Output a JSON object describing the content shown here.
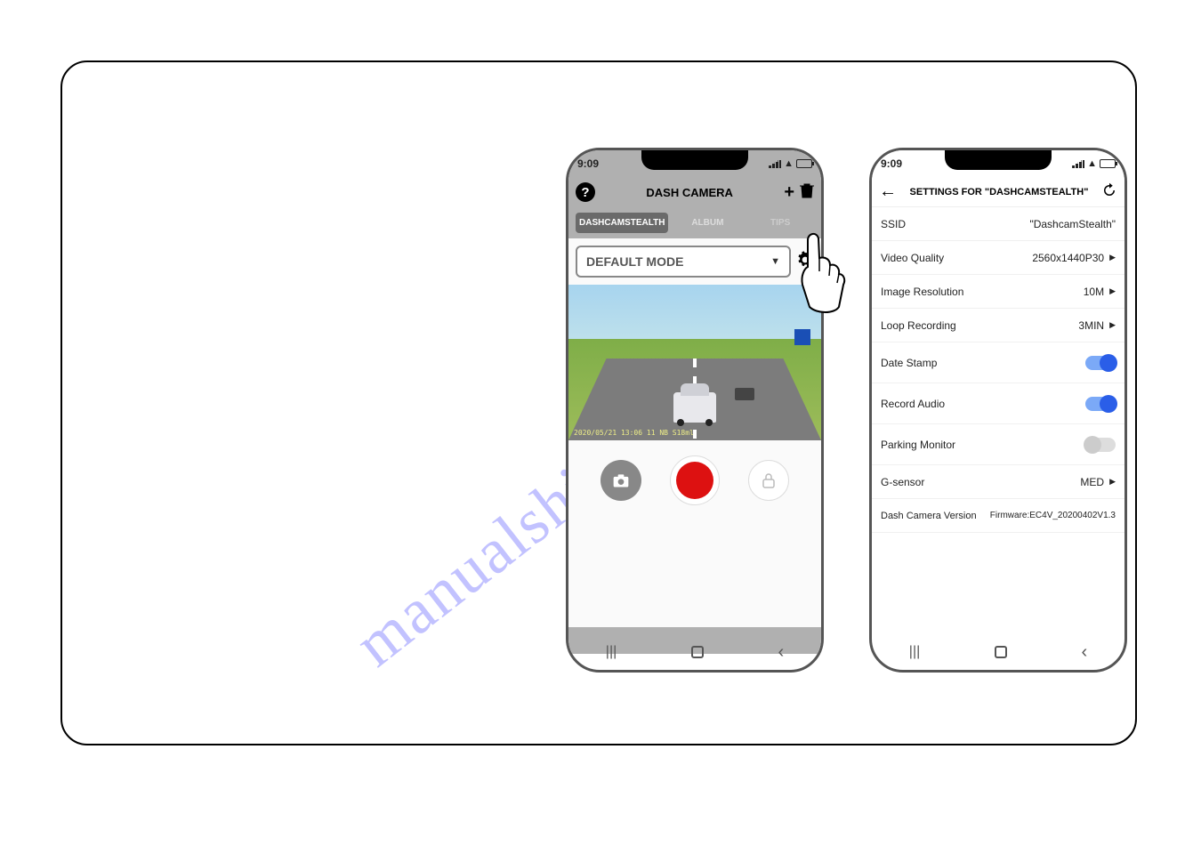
{
  "watermark": "manualshiver.com",
  "phoneLeft": {
    "time": "9:09",
    "appTitle": "DASH CAMERA",
    "tabs": {
      "active": "DASHCAMSTEALTH",
      "album": "ALBUM",
      "tips": "TIPS"
    },
    "modeLabel": "DEFAULT MODE",
    "overlayText": "2020/05/21 13:06 11 NB S18ml"
  },
  "phoneRight": {
    "time": "9:09",
    "settingsTitle": "SETTINGS FOR \"DASHCAMSTEALTH\"",
    "rows": {
      "ssid": {
        "label": "SSID",
        "value": "\"DashcamStealth\""
      },
      "videoQuality": {
        "label": "Video Quality",
        "value": "2560x1440P30"
      },
      "imageResolution": {
        "label": "Image Resolution",
        "value": "10M"
      },
      "loopRecording": {
        "label": "Loop Recording",
        "value": "3MIN"
      },
      "dateStamp": {
        "label": "Date Stamp"
      },
      "recordAudio": {
        "label": "Record Audio"
      },
      "parkingMonitor": {
        "label": "Parking Monitor"
      },
      "gSensor": {
        "label": "G-sensor",
        "value": "MED"
      },
      "version": {
        "label": "Dash Camera Version",
        "value": "Firmware:EC4V_20200402V1.3"
      }
    }
  }
}
